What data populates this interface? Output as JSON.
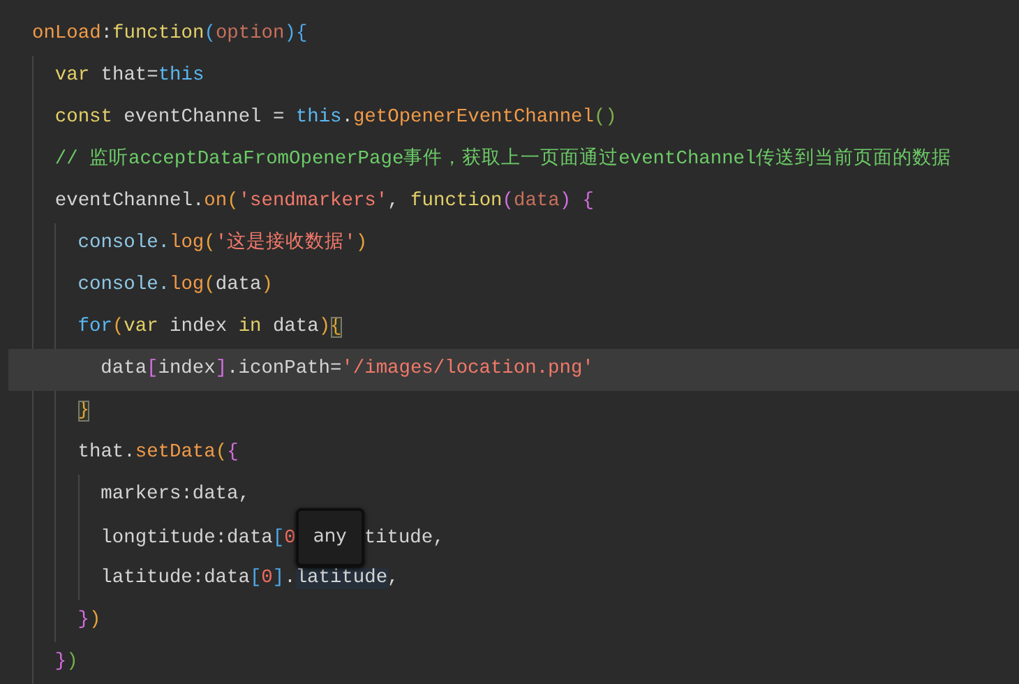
{
  "editor": {
    "lines": [
      {
        "tokens": [
          {
            "text": "onLoad",
            "kind": "prop"
          },
          {
            "text": ":",
            "kind": "plain"
          },
          {
            "text": "function",
            "kind": "key"
          },
          {
            "text": "(",
            "kind": "p3"
          },
          {
            "text": "option",
            "kind": "param"
          },
          {
            "text": "){",
            "kind": "p3"
          }
        ],
        "current": false,
        "children": [
          {
            "tokens": [
              {
                "text": "var",
                "kind": "key"
              },
              {
                "text": " that=",
                "kind": "plain"
              },
              {
                "text": "this",
                "kind": "this"
              }
            ],
            "current": false
          },
          {
            "tokens": [
              {
                "text": "const",
                "kind": "key"
              },
              {
                "text": " eventChannel = ",
                "kind": "plain"
              },
              {
                "text": "this",
                "kind": "this"
              },
              {
                "text": ".",
                "kind": "plain"
              },
              {
                "text": "getOpenerEventChannel",
                "kind": "prop"
              },
              {
                "text": "()",
                "kind": "p4"
              }
            ],
            "current": false
          },
          {
            "tokens": [
              {
                "text": "// 监听acceptDataFromOpenerPage事件，获取上一页面通过eventChannel传送到当前页面的数据",
                "kind": "comment"
              }
            ],
            "current": false
          },
          {
            "tokens": [
              {
                "text": "eventChannel.",
                "kind": "plain"
              },
              {
                "text": "on",
                "kind": "prop"
              },
              {
                "text": "(",
                "kind": "p1"
              },
              {
                "text": "'sendmarkers'",
                "kind": "str"
              },
              {
                "text": ", ",
                "kind": "plain"
              },
              {
                "text": "function",
                "kind": "key"
              },
              {
                "text": "(",
                "kind": "p2"
              },
              {
                "text": "data",
                "kind": "param"
              },
              {
                "text": ")",
                "kind": "p2"
              },
              {
                "text": " {",
                "kind": "p2"
              }
            ],
            "current": false,
            "children": [
              {
                "tokens": [
                  {
                    "text": "console.",
                    "kind": "plain2"
                  },
                  {
                    "text": "log",
                    "kind": "prop"
                  },
                  {
                    "text": "(",
                    "kind": "p1"
                  },
                  {
                    "text": "'这是接收数据'",
                    "kind": "str"
                  },
                  {
                    "text": ")",
                    "kind": "p1"
                  }
                ],
                "current": false
              },
              {
                "tokens": [
                  {
                    "text": "console.",
                    "kind": "plain2"
                  },
                  {
                    "text": "log",
                    "kind": "prop"
                  },
                  {
                    "text": "(",
                    "kind": "p1"
                  },
                  {
                    "text": "data",
                    "kind": "plain"
                  },
                  {
                    "text": ")",
                    "kind": "p1"
                  }
                ],
                "current": false
              },
              {
                "tokens": [
                  {
                    "text": "for",
                    "kind": "this"
                  },
                  {
                    "text": "(",
                    "kind": "p1"
                  },
                  {
                    "text": "var",
                    "kind": "key"
                  },
                  {
                    "text": " index ",
                    "kind": "plain"
                  },
                  {
                    "text": "in",
                    "kind": "key"
                  },
                  {
                    "text": " data",
                    "kind": "plain"
                  },
                  {
                    "text": ")",
                    "kind": "p1"
                  },
                  {
                    "text": "{",
                    "kind": "match"
                  }
                ],
                "current": false,
                "active_guide": true,
                "children": [
                  {
                    "tokens": [
                      {
                        "text": "data",
                        "kind": "plain"
                      },
                      {
                        "text": "[",
                        "kind": "p2"
                      },
                      {
                        "text": "index",
                        "kind": "plain"
                      },
                      {
                        "text": "]",
                        "kind": "p2"
                      },
                      {
                        "text": ".iconPath=",
                        "kind": "plain"
                      },
                      {
                        "text": "'/images/location.png'",
                        "kind": "str"
                      }
                    ],
                    "current": true
                  }
                ]
              },
              {
                "tokens": [
                  {
                    "text": "}",
                    "kind": "match"
                  }
                ],
                "current": false
              },
              {
                "tokens": [
                  {
                    "text": "that.",
                    "kind": "plain"
                  },
                  {
                    "text": "setData",
                    "kind": "prop"
                  },
                  {
                    "text": "(",
                    "kind": "p1"
                  },
                  {
                    "text": "{",
                    "kind": "p2"
                  }
                ],
                "current": false,
                "children": [
                  {
                    "tokens": [
                      {
                        "text": "markers:data,",
                        "kind": "plain"
                      }
                    ],
                    "current": false
                  },
                  {
                    "tokens": [
                      {
                        "text": "longtitude:data",
                        "kind": "plain"
                      },
                      {
                        "text": "[",
                        "kind": "p3"
                      },
                      {
                        "text": "0",
                        "kind": "num"
                      },
                      {
                        "text": "any",
                        "kind": "tooltip"
                      },
                      {
                        "text": "titude,",
                        "kind": "plain"
                      }
                    ],
                    "current": false
                  },
                  {
                    "tokens": [
                      {
                        "text": "latitude:data",
                        "kind": "plain"
                      },
                      {
                        "text": "[",
                        "kind": "p3"
                      },
                      {
                        "text": "0",
                        "kind": "num"
                      },
                      {
                        "text": "]",
                        "kind": "p3"
                      },
                      {
                        "text": ".",
                        "kind": "plain"
                      },
                      {
                        "text": "latitude",
                        "kind": "sel"
                      },
                      {
                        "text": ",",
                        "kind": "plain"
                      }
                    ],
                    "current": false
                  }
                ]
              },
              {
                "tokens": [
                  {
                    "text": "}",
                    "kind": "p2"
                  },
                  {
                    "text": ")",
                    "kind": "p1"
                  }
                ],
                "current": false
              }
            ]
          },
          {
            "tokens": [
              {
                "text": "}",
                "kind": "p2"
              },
              {
                "text": ")",
                "kind": "p5"
              }
            ],
            "current": false
          }
        ]
      }
    ]
  }
}
